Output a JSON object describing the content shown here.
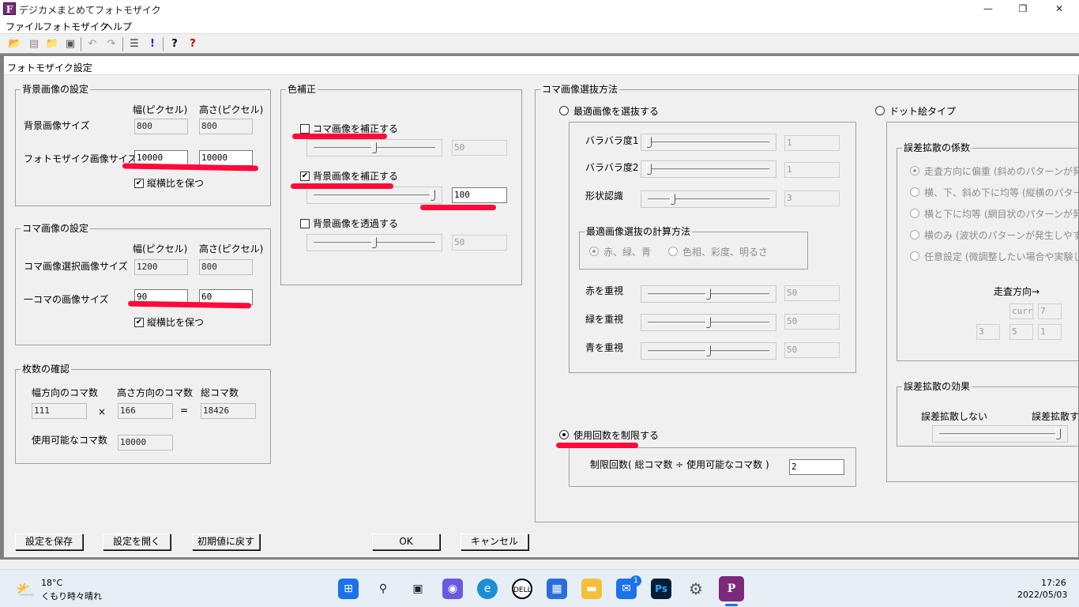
{
  "app": {
    "title": "デジカメまとめてフォトモザイク",
    "win_min": "—",
    "win_restore": "❐",
    "win_close": "✕",
    "icon_letter": "F"
  },
  "menu": [
    "ファイル",
    "フォトモザイク",
    "ヘルプ"
  ],
  "dialog": {
    "title": "フォトモザイク設定",
    "background": {
      "caption": "背景画像の設定",
      "col_width": "幅(ピクセル)",
      "col_height": "高さ(ピクセル)",
      "row_bg_size": "背景画像サイズ",
      "bg_w": "800",
      "bg_h": "800",
      "row_mosaic_size": "フォトモザイク画像サイズ",
      "mosaic_w": "10000",
      "mosaic_h": "10000",
      "keep_ratio": "縦横比を保つ"
    },
    "tile": {
      "caption": "コマ画像の設定",
      "col_width": "幅(ピクセル)",
      "col_height": "高さ(ピクセル)",
      "row_select": "コマ画像選択画像サイズ",
      "sel_w": "1200",
      "sel_h": "800",
      "row_one": "一コマの画像サイズ",
      "one_w": "90",
      "one_h": "60",
      "keep_ratio": "縦横比を保つ"
    },
    "count": {
      "caption": "枚数の確認",
      "w_label": "幅方向のコマ数",
      "h_label": "高さ方向のコマ数",
      "total_label": "総コマ数",
      "w_val": "111",
      "times": "×",
      "h_val": "166",
      "eq": "=",
      "total_val": "18426",
      "usable_label": "使用可能なコマ数",
      "usable_val": "10000"
    },
    "color": {
      "caption": "色補正",
      "tile_correct": "コマ画像を補正する",
      "tile_val": "50",
      "tile_level": 0.5,
      "bg_correct": "背景画像を補正する",
      "bg_val": "100",
      "bg_level": 1.0,
      "bg_transparent": "背景画像を透過する",
      "transparent_val": "50",
      "transparent_level": 0.5
    },
    "select": {
      "caption": "コマ画像選抜方法",
      "optimal": "最適画像を選抜する",
      "barabara1": "バラバラ度1",
      "barabara1_val": "1",
      "barabara1_level": 0.0,
      "barabara2": "バラバラ度2",
      "barabara2_val": "1",
      "barabara2_level": 0.0,
      "shape": "形状認識",
      "shape_val": "3",
      "shape_level": 0.2,
      "calc_caption": "最適画像選抜の計算方法",
      "calc_rgb": "赤、緑、青",
      "calc_hsv": "色相、彩度、明るさ",
      "red": "赤を重視",
      "red_val": "50",
      "green": "緑を重視",
      "green_val": "50",
      "blue": "青を重視",
      "blue_val": "50",
      "limit": "使用回数を制限する",
      "limit_label": "制限回数( 総コマ数 ÷ 使用可能なコマ数 )",
      "limit_val": "2",
      "dot": "ドット絵タイプ",
      "diff_caption": "誤差拡散の係数",
      "diff_opt1": "走査方向に偏重 (斜めのパターンが発",
      "diff_opt2": "横、下、斜め下に均等 (縦横のパターン",
      "diff_opt3": "横と下に均等 (網目状のパターンが発",
      "diff_opt4": "横のみ (波状のパターンが発生しやすい",
      "diff_opt5": "任意設定 (微調整したい場合や実験し",
      "scan_dir": "走査方向→",
      "grid_curr": "curr",
      "grid_7": "7",
      "grid_3": "3",
      "grid_5": "5",
      "grid_1": "1",
      "effect_caption": "誤差拡散の効果",
      "effect_none": "誤差拡散しない",
      "effect_do": "誤差拡散す",
      "effect_level": 1.0
    },
    "buttons": {
      "save": "設定を保存",
      "open": "設定を開く",
      "reset": "初期値に戻す",
      "ok": "OK",
      "cancel": "キャンセル"
    }
  },
  "taskbar": {
    "weather_temp": "18°C",
    "weather_text": "くもり時々晴れ",
    "time": "17:26",
    "date": "2022/05/03",
    "mail_badge": "1"
  }
}
